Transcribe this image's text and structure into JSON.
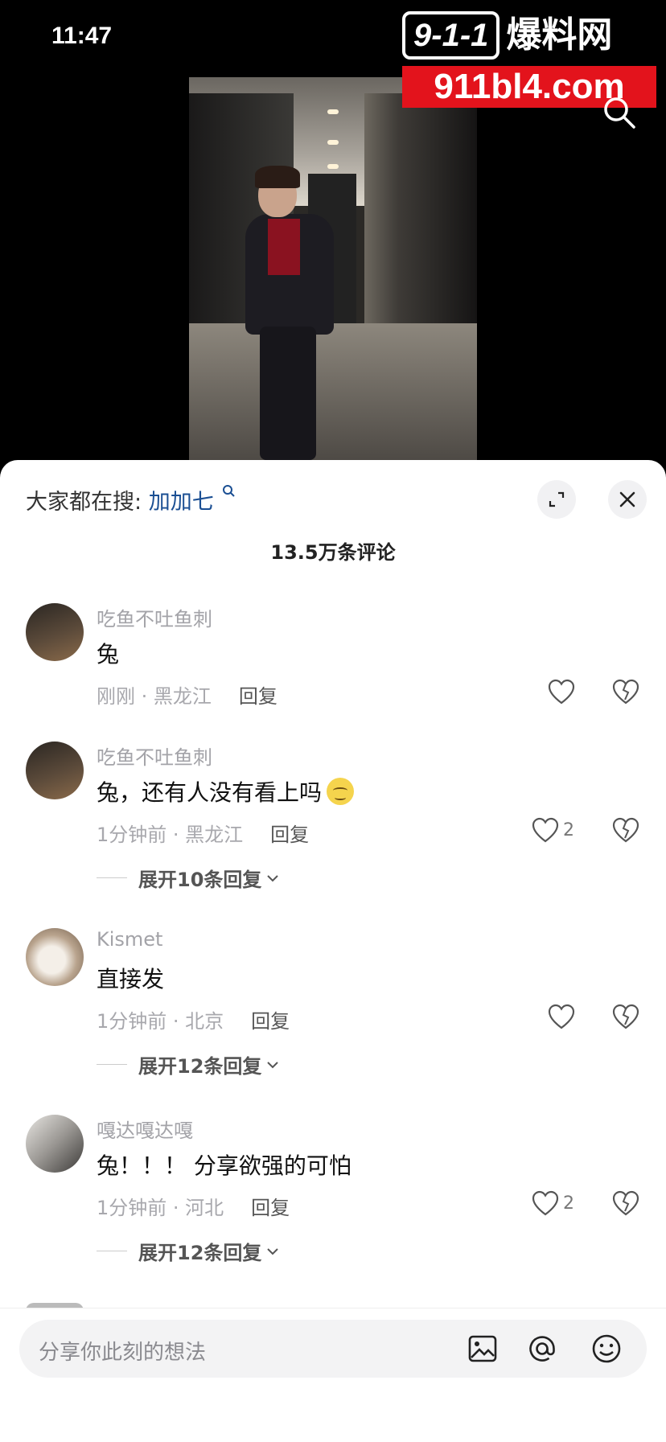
{
  "status_bar": {
    "time": "11:47"
  },
  "watermark": {
    "logo": "9-1-1",
    "name": "爆料网",
    "url": "911bl4.com"
  },
  "video": {
    "search_icon": "search-icon"
  },
  "sheet": {
    "trending_label": "大家都在搜:",
    "trending_term": "加加七",
    "comment_count": "13.5万条评论",
    "input_placeholder": "分享你此刻的想法"
  },
  "comments": [
    {
      "user": "吃鱼不吐鱼刺",
      "text": "兔",
      "meta": "刚刚 · 黑龙江",
      "reply": "回复",
      "likes": "",
      "expand": ""
    },
    {
      "user": "吃鱼不吐鱼刺",
      "text": "兔，还有人没有看上吗",
      "meta": "1分钟前 · 黑龙江",
      "reply": "回复",
      "likes": "2",
      "expand": "展开10条回复"
    },
    {
      "user": "Kismet",
      "text": "直接发",
      "meta": "1分钟前 · 北京",
      "reply": "回复",
      "likes": "",
      "expand": "展开12条回复"
    },
    {
      "user": "嘎达嘎达嘎",
      "text": "兔！！！ 分享欲强的可怕",
      "meta": "1分钟前 · 河北",
      "reply": "回复",
      "likes": "2",
      "expand": "展开12条回复"
    }
  ]
}
